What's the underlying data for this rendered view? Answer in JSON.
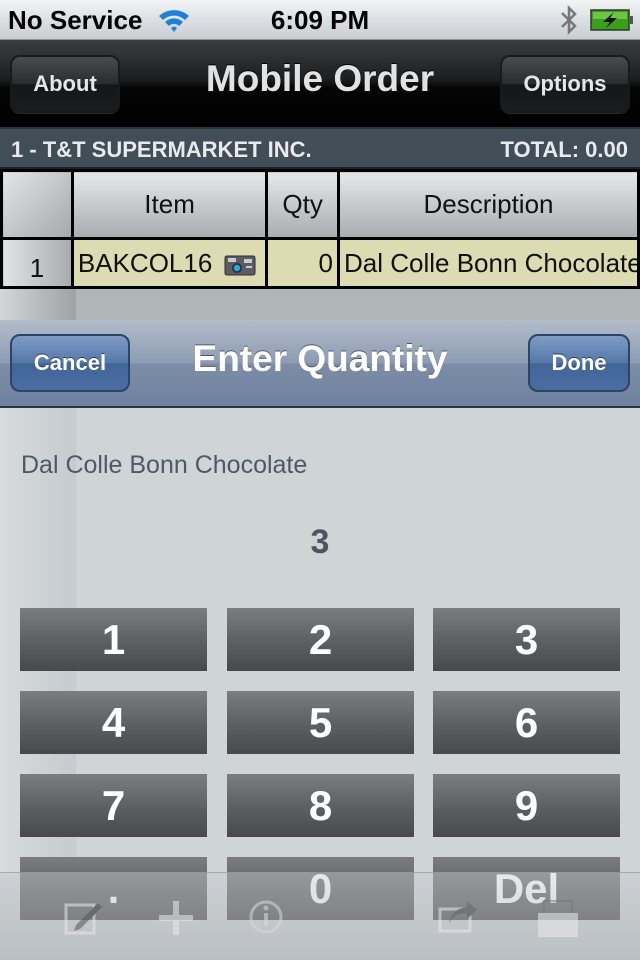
{
  "status_bar": {
    "carrier": "No Service",
    "time": "6:09 PM",
    "icons": [
      "wifi-icon",
      "bluetooth-icon",
      "battery-charging-icon"
    ]
  },
  "nav_bar": {
    "title": "Mobile Order",
    "left_button": "About",
    "right_button": "Options"
  },
  "customer_bar": {
    "customer": "1 - T&T SUPERMARKET INC.",
    "total": "TOTAL: 0.00"
  },
  "grid": {
    "columns": [
      "Item",
      "Qty",
      "Description"
    ],
    "rows": [
      {
        "row_number": "1",
        "item": "BAKCOL16",
        "item_icon": "camera-icon",
        "qty": "0",
        "description": "Dal Colle Bonn Chocolate"
      }
    ]
  },
  "dialog": {
    "title": "Enter Quantity",
    "cancel_label": "Cancel",
    "done_label": "Done",
    "description": "Dal Colle Bonn Chocolate",
    "value": "3",
    "keys": [
      "1",
      "2",
      "3",
      "4",
      "5",
      "6",
      "7",
      "8",
      "9",
      ".",
      "0",
      "Del"
    ]
  },
  "toolbar": {
    "icons": [
      "compose-icon",
      "add-icon",
      "info-icon",
      "share-icon",
      "printer-icon"
    ]
  },
  "colors": {
    "nav_bg": "#000000",
    "customer_bar_bg": "#414d57",
    "grid_cell_bg": "#dcdbb2",
    "dialog_header": "#8d9cb2",
    "dialog_button": "#4a6ea2",
    "keypad_key": "#5d5e60",
    "dialog_bg": "#cfd4d7"
  }
}
